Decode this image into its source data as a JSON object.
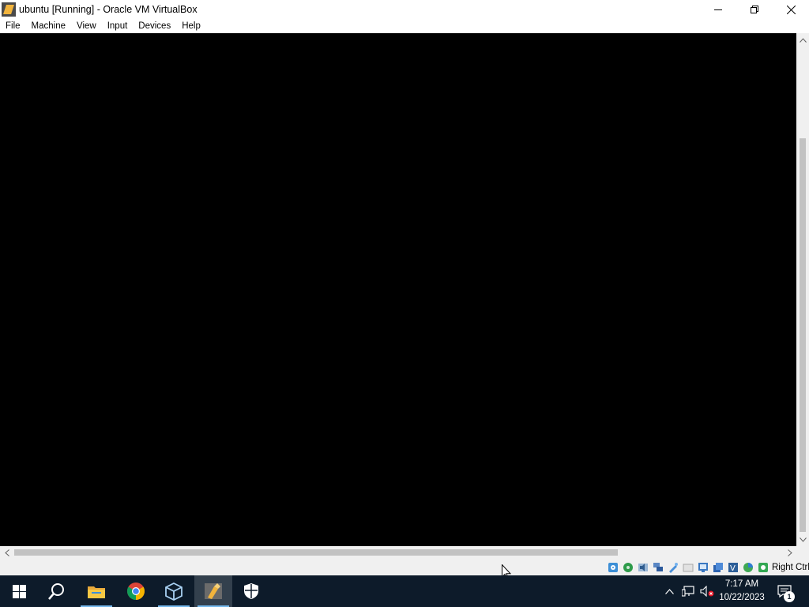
{
  "window": {
    "title": "ubuntu [Running] - Oracle VM VirtualBox",
    "app_icon": "virtualbox-vm-icon",
    "controls": [
      "minimize-icon",
      "restore-icon",
      "close-icon"
    ]
  },
  "menubar": {
    "items": [
      {
        "label": "File"
      },
      {
        "label": "Machine"
      },
      {
        "label": "View"
      },
      {
        "label": "Input"
      },
      {
        "label": "Devices"
      },
      {
        "label": "Help"
      }
    ]
  },
  "vm_display": {
    "background": "#000000"
  },
  "statusbar": {
    "icons": [
      "hard-disk-icon",
      "optical-drive-icon",
      "audio-icon",
      "network-icon",
      "usb-icon",
      "shared-folders-icon",
      "display-icon",
      "video-capture-icon",
      "virtualization-icon",
      "cpu-icon",
      "mouse-integration-icon"
    ],
    "host_key": "Right Ctrl"
  },
  "taskbar": {
    "items": [
      {
        "name": "start-button",
        "icon": "windows-logo-icon"
      },
      {
        "name": "search-button",
        "icon": "search-icon"
      },
      {
        "name": "file-explorer-button",
        "icon": "folder-icon"
      },
      {
        "name": "chrome-button",
        "icon": "chrome-icon"
      },
      {
        "name": "virtualbox-manager-button",
        "icon": "cube-icon"
      },
      {
        "name": "virtualbox-vm-button",
        "icon": "virtualbox-vm-icon",
        "active": true
      },
      {
        "name": "windows-security-button",
        "icon": "shield-icon"
      }
    ],
    "tray": {
      "icons": [
        "chevron-up-icon",
        "network-icon",
        "volume-muted-icon"
      ],
      "time": "7:17 AM",
      "date": "10/22/2023",
      "notification_count": "1"
    }
  },
  "colors": {
    "taskbar": "#0d1b2a",
    "accent": "#76b9ed"
  }
}
